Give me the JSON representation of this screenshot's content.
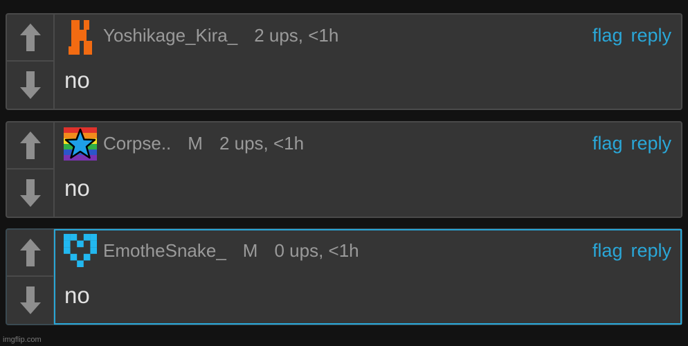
{
  "comments": [
    {
      "username": "Yoshikage_Kira_",
      "badge": "",
      "stats": "2 ups, <1h",
      "body": "no",
      "flag_label": "flag",
      "reply_label": "reply",
      "avatar_icon": "orange-pixel-castle-icon",
      "highlighted": false
    },
    {
      "username": "Corpse..",
      "badge": "M",
      "stats": "2 ups, <1h",
      "body": "no",
      "flag_label": "flag",
      "reply_label": "reply",
      "avatar_icon": "rainbow-star-icon",
      "highlighted": false
    },
    {
      "username": "EmotheSnake_",
      "badge": "M",
      "stats": "0 ups, <1h",
      "body": "no",
      "flag_label": "flag",
      "reply_label": "reply",
      "avatar_icon": "blue-pixel-heart-icon",
      "highlighted": true
    }
  ],
  "watermark": "imgflip.com",
  "colors": {
    "background": "#121212",
    "card": "#353535",
    "card_border": "#4a4a4a",
    "link": "#2aa7d8",
    "meta_text": "#9a9a9a",
    "body_text": "#e2e2e2",
    "highlight_border": "#29a6d6"
  }
}
